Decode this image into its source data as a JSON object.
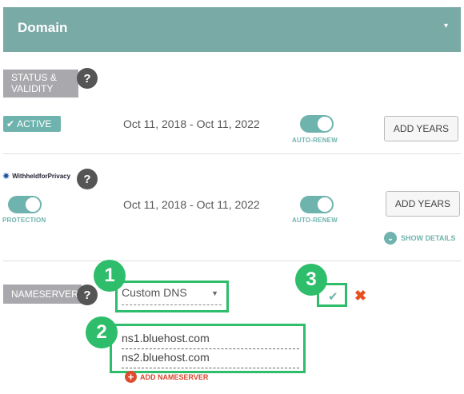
{
  "header": {
    "title": "Domain",
    "caret": "▾"
  },
  "status": {
    "tag": "STATUS & VALIDITY",
    "help": "?",
    "badge_check": "✔",
    "badge_label": "ACTIVE",
    "dates": "Oct 11, 2018 - Oct 11, 2022",
    "auto_renew_label": "AUTO-RENEW",
    "auto_renew_on": true,
    "add_years_label": "ADD YEARS"
  },
  "privacy": {
    "logo_text": "WithheldforPrivacy",
    "help": "?",
    "protection_label": "PROTECTION",
    "dates": "Oct 11, 2018 - Oct 11, 2022",
    "auto_renew_label": "AUTO-RENEW",
    "add_years_label": "ADD YEARS",
    "show_details_label": "SHOW DETAILS",
    "show_details_icon": "⌄"
  },
  "nameservers": {
    "tag": "NAMESERVERS",
    "help": "?",
    "dns_option": "Custom DNS",
    "dns_caret": "▼",
    "servers": [
      "ns1.bluehost.com",
      "ns2.bluehost.com"
    ],
    "add_label": "ADD NAMESERVER",
    "add_icon": "+",
    "confirm_icon": "✔",
    "cancel_icon": "✖"
  },
  "callouts": [
    "1",
    "2",
    "3"
  ],
  "colors": {
    "header": "#7aaaa6",
    "accent": "#6fb3ae",
    "callout": "#2ebd6a",
    "danger": "#e8501e"
  }
}
